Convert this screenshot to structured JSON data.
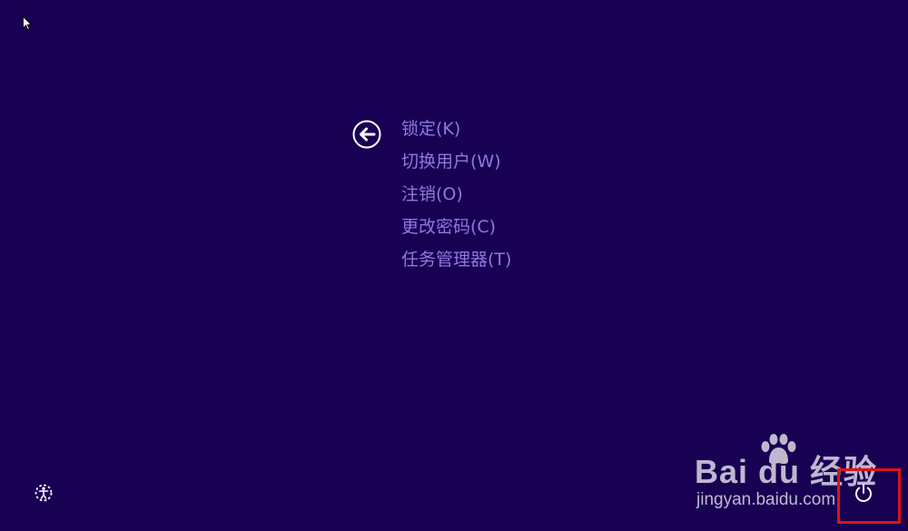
{
  "icons": {
    "cursor": "mouse-pointer-icon",
    "back": "back-arrow-icon",
    "ease_of_access": "ease-of-access-icon",
    "power": "power-icon"
  },
  "menu": {
    "items": [
      {
        "label": "锁定(K)"
      },
      {
        "label": "切换用户(W)"
      },
      {
        "label": "注销(O)"
      },
      {
        "label": "更改密码(C)"
      },
      {
        "label": "任务管理器(T)"
      }
    ]
  },
  "watermark": {
    "logo_text": "Bai du 经验",
    "url": "jingyan.baidu.com"
  },
  "colors": {
    "background": "#180052",
    "menu_text": "#8f78e0",
    "highlight": "#e01313",
    "icon": "#ffffff"
  }
}
